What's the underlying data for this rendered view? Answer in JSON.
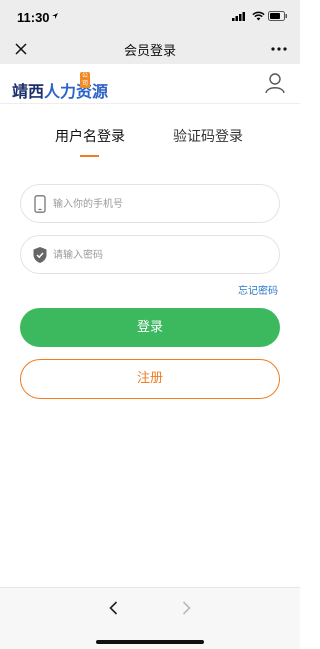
{
  "status_bar": {
    "time": "11:30"
  },
  "nav": {
    "title": "会员登录",
    "close_icon": "close-icon",
    "more_icon": "more-icon"
  },
  "header": {
    "logo_part1": "靖西",
    "logo_part2": "人力资源",
    "logo_badge": "公司",
    "user_icon": "user-icon"
  },
  "tabs": [
    {
      "label": "用户名登录",
      "active": true
    },
    {
      "label": "验证码登录",
      "active": false
    }
  ],
  "form": {
    "phone_placeholder": "输入你的手机号",
    "password_placeholder": "请输入密码",
    "forgot_label": "忘记密码",
    "login_label": "登录",
    "register_label": "注册"
  },
  "colors": {
    "accent_orange": "#f07d24",
    "login_green": "#3cb95f",
    "link_blue": "#2a78c8"
  }
}
